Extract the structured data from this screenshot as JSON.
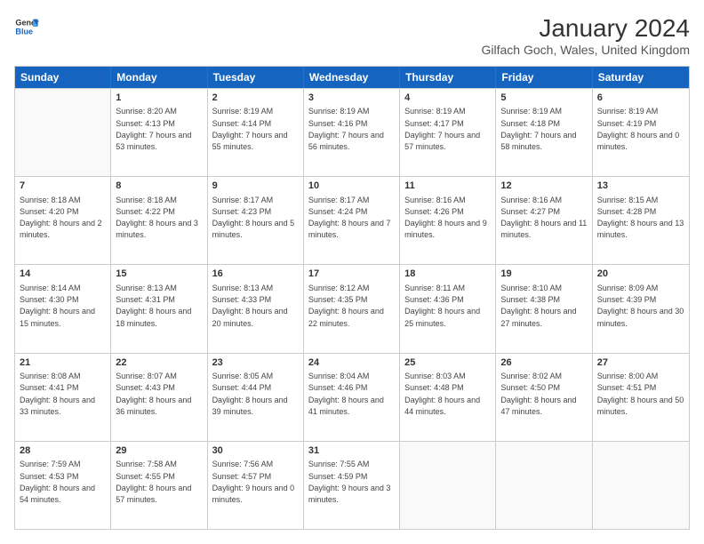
{
  "logo": {
    "line1": "General",
    "line2": "Blue"
  },
  "title": "January 2024",
  "subtitle": "Gilfach Goch, Wales, United Kingdom",
  "days": [
    "Sunday",
    "Monday",
    "Tuesday",
    "Wednesday",
    "Thursday",
    "Friday",
    "Saturday"
  ],
  "weeks": [
    [
      {
        "date": "",
        "sunrise": "",
        "sunset": "",
        "daylight": ""
      },
      {
        "date": "1",
        "sunrise": "8:20 AM",
        "sunset": "4:13 PM",
        "daylight": "7 hours and 53 minutes."
      },
      {
        "date": "2",
        "sunrise": "8:19 AM",
        "sunset": "4:14 PM",
        "daylight": "7 hours and 55 minutes."
      },
      {
        "date": "3",
        "sunrise": "8:19 AM",
        "sunset": "4:16 PM",
        "daylight": "7 hours and 56 minutes."
      },
      {
        "date": "4",
        "sunrise": "8:19 AM",
        "sunset": "4:17 PM",
        "daylight": "7 hours and 57 minutes."
      },
      {
        "date": "5",
        "sunrise": "8:19 AM",
        "sunset": "4:18 PM",
        "daylight": "7 hours and 58 minutes."
      },
      {
        "date": "6",
        "sunrise": "8:19 AM",
        "sunset": "4:19 PM",
        "daylight": "8 hours and 0 minutes."
      }
    ],
    [
      {
        "date": "7",
        "sunrise": "8:18 AM",
        "sunset": "4:20 PM",
        "daylight": "8 hours and 2 minutes."
      },
      {
        "date": "8",
        "sunrise": "8:18 AM",
        "sunset": "4:22 PM",
        "daylight": "8 hours and 3 minutes."
      },
      {
        "date": "9",
        "sunrise": "8:17 AM",
        "sunset": "4:23 PM",
        "daylight": "8 hours and 5 minutes."
      },
      {
        "date": "10",
        "sunrise": "8:17 AM",
        "sunset": "4:24 PM",
        "daylight": "8 hours and 7 minutes."
      },
      {
        "date": "11",
        "sunrise": "8:16 AM",
        "sunset": "4:26 PM",
        "daylight": "8 hours and 9 minutes."
      },
      {
        "date": "12",
        "sunrise": "8:16 AM",
        "sunset": "4:27 PM",
        "daylight": "8 hours and 11 minutes."
      },
      {
        "date": "13",
        "sunrise": "8:15 AM",
        "sunset": "4:28 PM",
        "daylight": "8 hours and 13 minutes."
      }
    ],
    [
      {
        "date": "14",
        "sunrise": "8:14 AM",
        "sunset": "4:30 PM",
        "daylight": "8 hours and 15 minutes."
      },
      {
        "date": "15",
        "sunrise": "8:13 AM",
        "sunset": "4:31 PM",
        "daylight": "8 hours and 18 minutes."
      },
      {
        "date": "16",
        "sunrise": "8:13 AM",
        "sunset": "4:33 PM",
        "daylight": "8 hours and 20 minutes."
      },
      {
        "date": "17",
        "sunrise": "8:12 AM",
        "sunset": "4:35 PM",
        "daylight": "8 hours and 22 minutes."
      },
      {
        "date": "18",
        "sunrise": "8:11 AM",
        "sunset": "4:36 PM",
        "daylight": "8 hours and 25 minutes."
      },
      {
        "date": "19",
        "sunrise": "8:10 AM",
        "sunset": "4:38 PM",
        "daylight": "8 hours and 27 minutes."
      },
      {
        "date": "20",
        "sunrise": "8:09 AM",
        "sunset": "4:39 PM",
        "daylight": "8 hours and 30 minutes."
      }
    ],
    [
      {
        "date": "21",
        "sunrise": "8:08 AM",
        "sunset": "4:41 PM",
        "daylight": "8 hours and 33 minutes."
      },
      {
        "date": "22",
        "sunrise": "8:07 AM",
        "sunset": "4:43 PM",
        "daylight": "8 hours and 36 minutes."
      },
      {
        "date": "23",
        "sunrise": "8:05 AM",
        "sunset": "4:44 PM",
        "daylight": "8 hours and 39 minutes."
      },
      {
        "date": "24",
        "sunrise": "8:04 AM",
        "sunset": "4:46 PM",
        "daylight": "8 hours and 41 minutes."
      },
      {
        "date": "25",
        "sunrise": "8:03 AM",
        "sunset": "4:48 PM",
        "daylight": "8 hours and 44 minutes."
      },
      {
        "date": "26",
        "sunrise": "8:02 AM",
        "sunset": "4:50 PM",
        "daylight": "8 hours and 47 minutes."
      },
      {
        "date": "27",
        "sunrise": "8:00 AM",
        "sunset": "4:51 PM",
        "daylight": "8 hours and 50 minutes."
      }
    ],
    [
      {
        "date": "28",
        "sunrise": "7:59 AM",
        "sunset": "4:53 PM",
        "daylight": "8 hours and 54 minutes."
      },
      {
        "date": "29",
        "sunrise": "7:58 AM",
        "sunset": "4:55 PM",
        "daylight": "8 hours and 57 minutes."
      },
      {
        "date": "30",
        "sunrise": "7:56 AM",
        "sunset": "4:57 PM",
        "daylight": "9 hours and 0 minutes."
      },
      {
        "date": "31",
        "sunrise": "7:55 AM",
        "sunset": "4:59 PM",
        "daylight": "9 hours and 3 minutes."
      },
      {
        "date": "",
        "sunrise": "",
        "sunset": "",
        "daylight": ""
      },
      {
        "date": "",
        "sunrise": "",
        "sunset": "",
        "daylight": ""
      },
      {
        "date": "",
        "sunrise": "",
        "sunset": "",
        "daylight": ""
      }
    ]
  ]
}
